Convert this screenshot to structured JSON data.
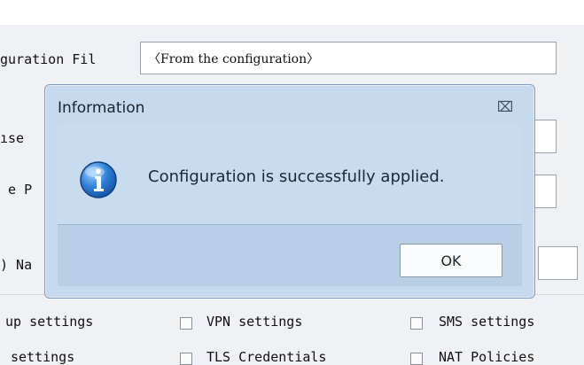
{
  "background_form": {
    "config_file_label": "guration Fil",
    "config_file_value": "〈From the configuration〉",
    "row2_label": "ıse",
    "row3_label": " e P",
    "row4_label": ") Na",
    "checkboxes": [
      {
        "label": "up settings"
      },
      {
        "label": "VPN settings"
      },
      {
        "label": "SMS settings"
      },
      {
        "label": "settings"
      },
      {
        "label": "TLS Credentials"
      },
      {
        "label": "NAT Policies"
      }
    ]
  },
  "dialog": {
    "title": "Information",
    "close_icon": "⌧",
    "icon": "info-icon",
    "message": "Configuration is successfully applied.",
    "ok_label": "OK"
  }
}
